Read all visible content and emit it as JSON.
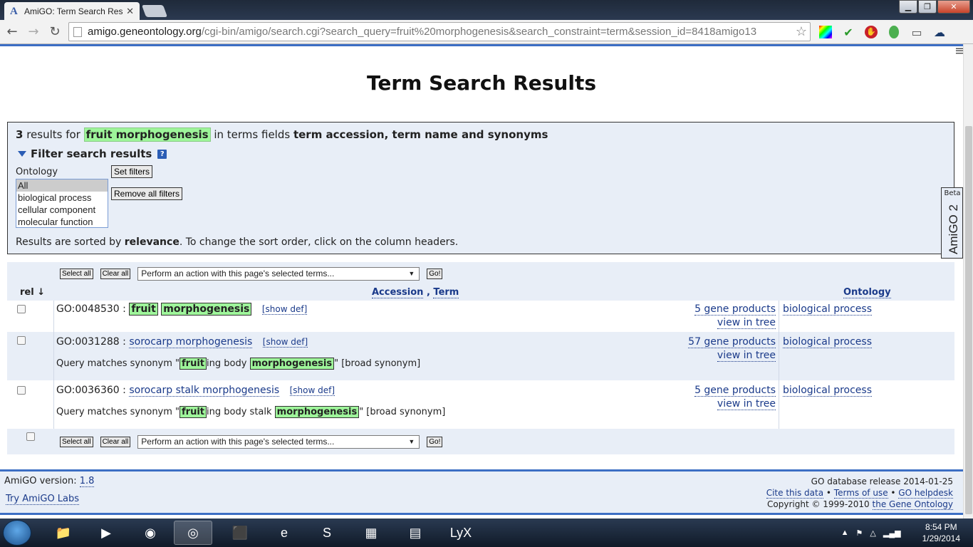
{
  "browser": {
    "tab_title": "AmiGO: Term Search Resu",
    "url_host": "amigo.geneontology.org",
    "url_path": "/cgi-bin/amigo/search.cgi?search_query=fruit%20morphogenesis&search_constraint=term&session_id=8418amigo13"
  },
  "page": {
    "title": "Term Search Results"
  },
  "summary": {
    "count": "3",
    "text1": " results for ",
    "query": "fruit morphogenesis",
    "text2": " in terms fields ",
    "fields": "term accession, term name and synonyms"
  },
  "filters": {
    "heading": "Filter search results",
    "ontology_label": "Ontology",
    "ontology_options": [
      "All",
      "biological process",
      "cellular component",
      "molecular function"
    ],
    "set_label": "Set filters",
    "remove_label": "Remove all filters"
  },
  "sort_note": {
    "pre": "Results are sorted by ",
    "key": "relevance",
    "post": ". To change the sort order, click on the column headers."
  },
  "actions": {
    "select_all": "Select all",
    "clear_all": "Clear all",
    "action_placeholder": "Perform an action with this page's selected terms...",
    "go": "Go!"
  },
  "columns": {
    "rel": "rel ↓",
    "accession": "Accession",
    "sep": " , ",
    "term": "Term",
    "ontology": "Ontology"
  },
  "results": [
    {
      "acc": "GO:0048530",
      "term_hl1": "fruit",
      "term_hl2": "morphogenesis",
      "show_def": "[show def]",
      "gene_products": "5 gene products",
      "view_tree": "view in tree",
      "ontology": "biological process"
    },
    {
      "acc": "GO:0031288",
      "term": "sorocarp morphogenesis",
      "show_def": "[show def]",
      "syn_pre": "Query matches synonym \"",
      "syn_hl1": "fruit",
      "syn_mid": "ing body ",
      "syn_hl2": "morphogenesis",
      "syn_post": "\" [broad synonym]",
      "gene_products": "57 gene products",
      "view_tree": "view in tree",
      "ontology": "biological process"
    },
    {
      "acc": "GO:0036360",
      "term": "sorocarp stalk morphogenesis",
      "show_def": "[show def]",
      "syn_pre": "Query matches synonym \"",
      "syn_hl1": "fruit",
      "syn_mid": "ing body stalk ",
      "syn_hl2": "morphogenesis",
      "syn_post": "\" [broad synonym]",
      "gene_products": "5 gene products",
      "view_tree": "view in tree",
      "ontology": "biological process"
    }
  ],
  "footer": {
    "version_label": "AmiGO version: ",
    "version": "1.8",
    "labs": "Try AmiGO Labs",
    "release": "GO database release 2014-01-25",
    "cite": "Cite this data",
    "terms": "Terms of use",
    "helpdesk": "GO helpdesk",
    "bullet": " • ",
    "copyright": "Copyright © 1999-2010 ",
    "go_link": "the Gene Ontology"
  },
  "amigo2": {
    "beta": "Beta",
    "name": "AmiGO 2"
  },
  "taskbar": {
    "time": "8:54 PM",
    "date": "1/29/2014"
  }
}
